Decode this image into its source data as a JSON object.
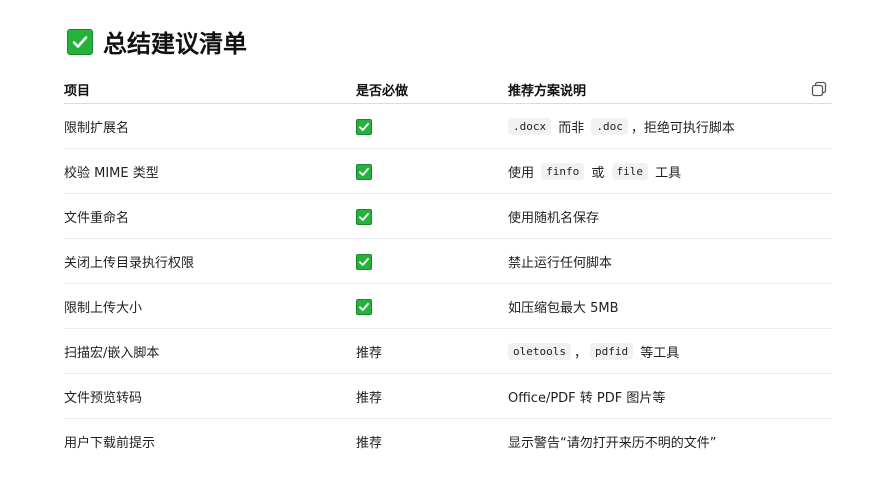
{
  "heading": {
    "title": "总结建议清单",
    "icon": "check-mark-button-icon"
  },
  "table": {
    "headers": [
      "项目",
      "是否必做",
      "推荐方案说明"
    ],
    "copy_icon": "copy-icon",
    "rows": [
      {
        "item": "限制扩展名",
        "required": "check",
        "desc": [
          {
            "t": "code",
            "v": ".docx"
          },
          {
            "t": "text",
            "v": " 而非 "
          },
          {
            "t": "code",
            "v": ".doc"
          },
          {
            "t": "text",
            "v": "，拒绝可执行脚本"
          }
        ]
      },
      {
        "item": "校验 MIME 类型",
        "required": "check",
        "desc": [
          {
            "t": "text",
            "v": "使用 "
          },
          {
            "t": "code",
            "v": "finfo"
          },
          {
            "t": "text",
            "v": " 或 "
          },
          {
            "t": "code",
            "v": "file"
          },
          {
            "t": "text",
            "v": " 工具"
          }
        ]
      },
      {
        "item": "文件重命名",
        "required": "check",
        "desc": [
          {
            "t": "text",
            "v": "使用随机名保存"
          }
        ]
      },
      {
        "item": "关闭上传目录执行权限",
        "required": "check",
        "desc": [
          {
            "t": "text",
            "v": "禁止运行任何脚本"
          }
        ]
      },
      {
        "item": "限制上传大小",
        "required": "check",
        "desc": [
          {
            "t": "text",
            "v": "如压缩包最大 5MB"
          }
        ]
      },
      {
        "item": "扫描宏/嵌入脚本",
        "required": "推荐",
        "desc": [
          {
            "t": "code",
            "v": "oletools"
          },
          {
            "t": "text",
            "v": "，"
          },
          {
            "t": "code",
            "v": "pdfid"
          },
          {
            "t": "text",
            "v": " 等工具"
          }
        ]
      },
      {
        "item": "文件预览转码",
        "required": "推荐",
        "desc": [
          {
            "t": "text",
            "v": "Office/PDF 转 PDF 图片等"
          }
        ]
      },
      {
        "item": "用户下载前提示",
        "required": "推荐",
        "desc": [
          {
            "t": "text",
            "v": "显示警告“请勿打开来历不明的文件”"
          }
        ]
      }
    ]
  },
  "colors": {
    "check_green": "#24b23a",
    "code_bg": "#f1f1f1"
  }
}
